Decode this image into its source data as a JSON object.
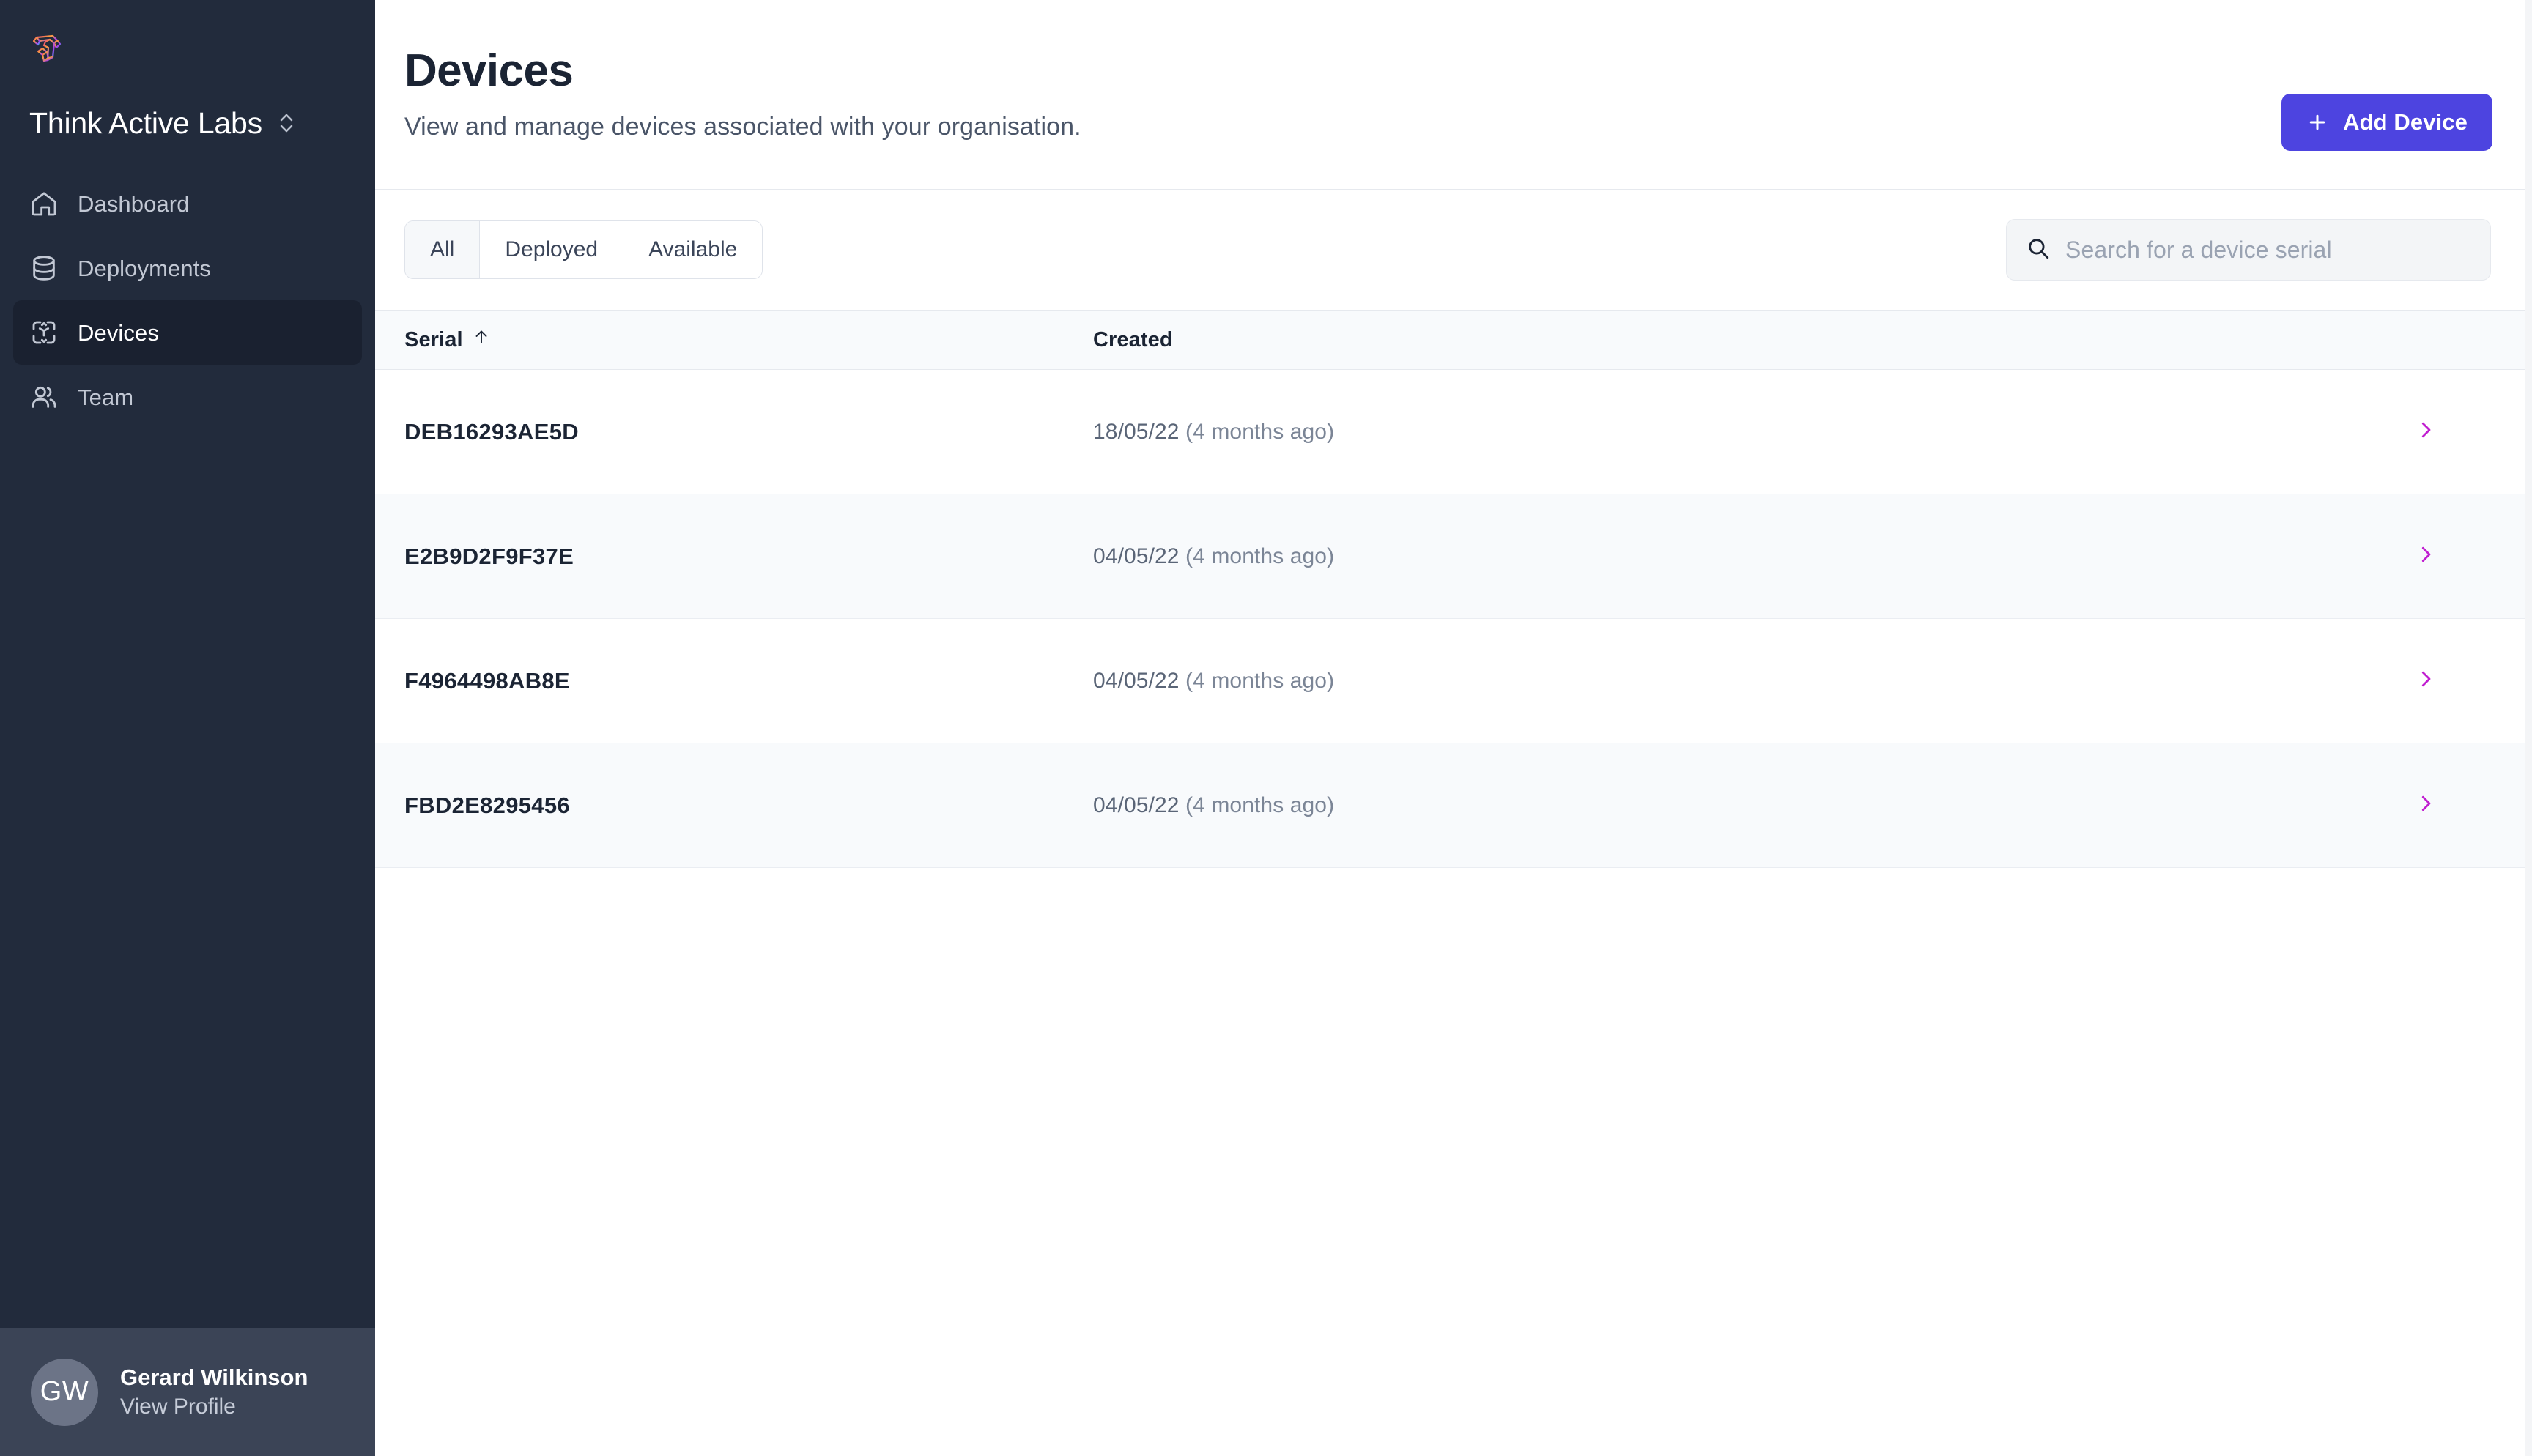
{
  "brand": {
    "logo_icon": "think-active-labs-logo",
    "org_name": "Think Active Labs",
    "switcher_icon": "chevron-up-down-icon"
  },
  "sidebar": {
    "items": [
      {
        "label": "Dashboard",
        "icon": "home-icon",
        "active": false
      },
      {
        "label": "Deployments",
        "icon": "database-icon",
        "active": false
      },
      {
        "label": "Devices",
        "icon": "cube-scan-icon",
        "active": true
      },
      {
        "label": "Team",
        "icon": "users-icon",
        "active": false
      }
    ],
    "profile": {
      "initials": "GW",
      "name": "Gerard Wilkinson",
      "link_label": "View Profile"
    }
  },
  "header": {
    "title": "Devices",
    "subtitle": "View and manage devices associated with your organisation.",
    "add_button": {
      "label": "Add Device",
      "icon": "plus-icon"
    }
  },
  "toolbar": {
    "tabs": [
      {
        "label": "All",
        "active": true
      },
      {
        "label": "Deployed",
        "active": false
      },
      {
        "label": "Available",
        "active": false
      }
    ],
    "search": {
      "icon": "search-icon",
      "placeholder": "Search for a device serial",
      "value": ""
    }
  },
  "table": {
    "columns": [
      {
        "key": "serial",
        "label": "Serial",
        "sort": "asc",
        "sort_icon": "arrow-up-icon"
      },
      {
        "key": "created",
        "label": "Created",
        "sort": null,
        "sort_icon": null
      }
    ],
    "rows": [
      {
        "serial": "DEB16293AE5D",
        "created_date": "18/05/22",
        "created_ago": "(4 months ago)",
        "chevron": "chevron-right-icon"
      },
      {
        "serial": "E2B9D2F9F37E",
        "created_date": "04/05/22",
        "created_ago": "(4 months ago)",
        "chevron": "chevron-right-icon"
      },
      {
        "serial": "F4964498AB8E",
        "created_date": "04/05/22",
        "created_ago": "(4 months ago)",
        "chevron": "chevron-right-icon"
      },
      {
        "serial": "FBD2E8295456",
        "created_date": "04/05/22",
        "created_ago": "(4 months ago)",
        "chevron": "chevron-right-icon"
      }
    ]
  },
  "colors": {
    "sidebar_bg": "#222b3c",
    "sidebar_active_bg": "#1a2130",
    "profile_bg": "#3b4456",
    "accent": "#4d44e0",
    "chevron_accent": "#c01ed0",
    "heading": "#1b2434",
    "muted_text": "#5a6577",
    "row_stripe": "#f8fafc",
    "border": "#e6e9ee"
  }
}
